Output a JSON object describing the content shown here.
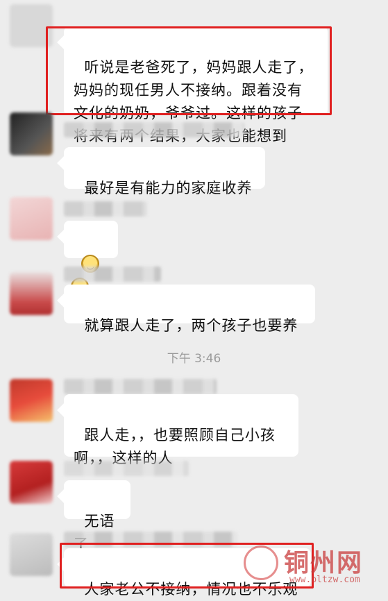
{
  "messages": [
    {
      "id": "m1",
      "text": "听说是老爸死了，妈妈跟人走了，\n妈妈的现任男人不接纳。跟着没有\n文化的奶奶，爷爷过。这样的孩子\n将来有两个结果，大家也能想到",
      "highlighted": true
    },
    {
      "id": "m2",
      "text": "最好是有能力的家庭收养",
      "highlighted": false
    },
    {
      "id": "m3",
      "text": "",
      "emoji": [
        "shy-face-icon",
        "shy-face-icon"
      ],
      "highlighted": false
    },
    {
      "id": "m4",
      "text": "就算跟人走了，两个孩子也要养",
      "highlighted": false
    },
    {
      "id": "m5",
      "text": "跟人走，，也要照顾自己小孩\n啊，，这样的人",
      "highlighted": false
    },
    {
      "id": "m6",
      "text": "无语了",
      "highlighted": false
    },
    {
      "id": "m7",
      "text": "人家老公不接纳，情况也不乐观",
      "highlighted": true
    }
  ],
  "timestamp": "下午 3:46",
  "watermark": {
    "title": "铜州网",
    "url": "www.bltzw.com"
  },
  "colors": {
    "background": "#ededed",
    "bubble": "#ffffff",
    "highlight": "#e02020"
  }
}
